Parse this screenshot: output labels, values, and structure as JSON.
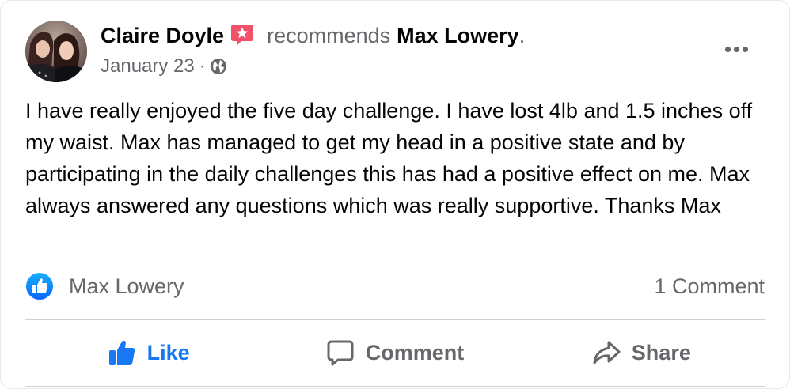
{
  "post": {
    "author": "Claire Doyle",
    "action_text": "recommends",
    "page": "Max Lowery",
    "page_punctuation": ".",
    "date": "January 23",
    "meta_separator": "·",
    "body": "I have really enjoyed the five day challenge. I have lost 4lb and 1.5 inches off my waist. Max has managed to get my head in a positive state and by participating in the daily challenges this has had a positive effect on me. Max always answered any questions which was really supportive. Thanks Max"
  },
  "icons": {
    "recommendation_badge": "star-badge-icon",
    "audience": "globe-icon",
    "more": "more-dots-icon",
    "reaction": "like-reaction-icon",
    "like": "thumbs-up-icon",
    "comment": "speech-bubble-icon",
    "share": "share-arrow-icon"
  },
  "reactions": {
    "reactor": "Max Lowery",
    "comments": "1 Comment"
  },
  "actions": {
    "like": "Like",
    "comment": "Comment",
    "share": "Share"
  },
  "colors": {
    "accent": "#1877f2",
    "badge": "#f25268",
    "muted_text": "#65676b",
    "divider": "#ced0d4"
  }
}
